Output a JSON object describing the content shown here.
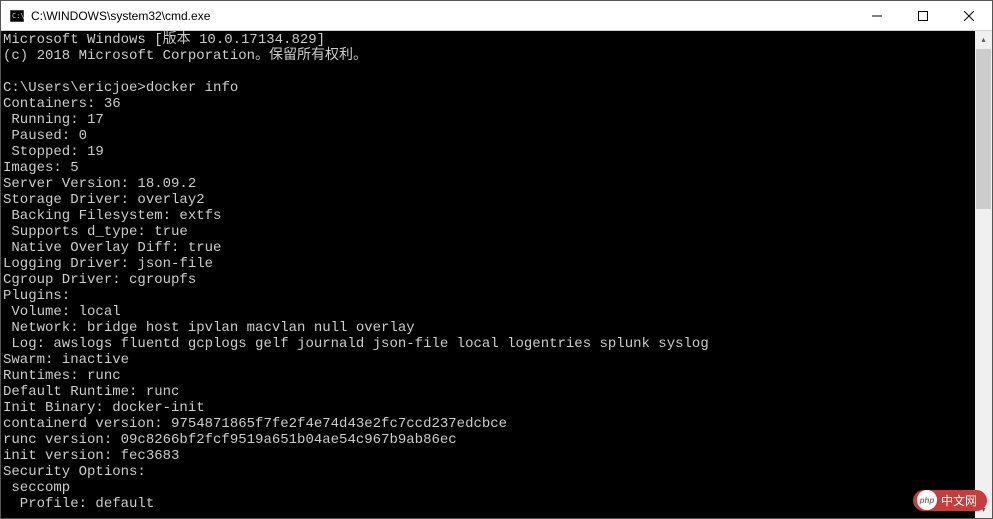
{
  "window": {
    "title": "C:\\WINDOWS\\system32\\cmd.exe"
  },
  "terminal": {
    "header_line1": "Microsoft Windows [版本 10.0.17134.829]",
    "header_line2": "(c) 2018 Microsoft Corporation。保留所有权利。",
    "prompt": "C:\\Users\\ericjoe>",
    "command": "docker info",
    "output": {
      "containers": "Containers: 36",
      "running": " Running: 17",
      "paused": " Paused: 0",
      "stopped": " Stopped: 19",
      "images": "Images: 5",
      "server_version": "Server Version: 18.09.2",
      "storage_driver": "Storage Driver: overlay2",
      "backing_fs": " Backing Filesystem: extfs",
      "supports_dtype": " Supports d_type: true",
      "native_overlay": " Native Overlay Diff: true",
      "logging_driver": "Logging Driver: json-file",
      "cgroup_driver": "Cgroup Driver: cgroupfs",
      "plugins": "Plugins:",
      "volume": " Volume: local",
      "network": " Network: bridge host ipvlan macvlan null overlay",
      "log": " Log: awslogs fluentd gcplogs gelf journald json-file local logentries splunk syslog",
      "swarm": "Swarm: inactive",
      "runtimes": "Runtimes: runc",
      "default_runtime": "Default Runtime: runc",
      "init_binary": "Init Binary: docker-init",
      "containerd_version": "containerd version: 9754871865f7fe2f4e74d43e2fc7ccd237edcbce",
      "runc_version": "runc version: 09c8266bf2fcf9519a651b04ae54c967b9ab86ec",
      "init_version": "init version: fec3683",
      "security_options": "Security Options:",
      "seccomp": " seccomp",
      "profile": "  Profile: default"
    }
  },
  "watermark": {
    "text": "中文网"
  }
}
